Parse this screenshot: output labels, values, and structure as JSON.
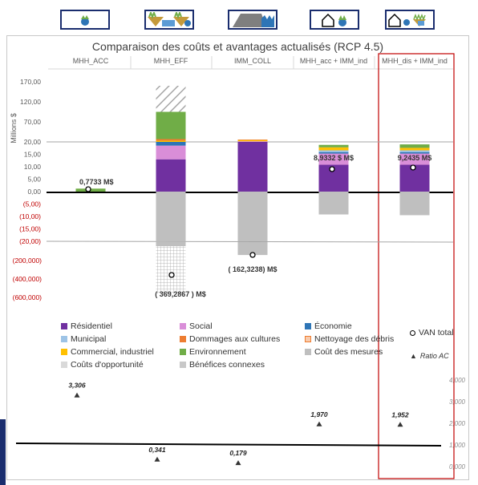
{
  "chart_data": {
    "type": "bar",
    "title": "Comparaison des coûts et avantages actualisés (RCP 4.5)",
    "ylabel": "Millions $",
    "categories": [
      "MHH_ACC",
      "MHH_EFF",
      "IMM_COLL",
      "MHH_acc + IMM_ind",
      "MHH_dis + IMM_ind"
    ],
    "highlighted_category": "MHH_dis + IMM_ind",
    "y_ticks_upper": [
      "170,00",
      "120,00",
      "70,00",
      "20,00"
    ],
    "y_ticks_middle": [
      "20,00",
      "15,00",
      "10,00",
      "5,00",
      "0,00",
      "(5,00)",
      "(10,00)",
      "(15,00)",
      "(20,00)"
    ],
    "y_ticks_lower": [
      "(200,000)",
      "(400,000)",
      "(600,000)"
    ],
    "series_colors": {
      "residentiel": "#7030a0",
      "social": "#d98ed8",
      "economie": "#2e75b6",
      "municipal": "#9dc3e6",
      "dommages_cultures": "#ed7d31",
      "nettoyage_debris": "#f8cbad",
      "commercial": "#ffc000",
      "environnement": "#70ad47",
      "cout_mesures": "#bfbfbf",
      "couts_opportunite": "#d9d9d9",
      "benefices_connexes": "#c8c8c8"
    },
    "npv_labels": [
      "0,7733 M$",
      "( 369,2867 ) M$",
      "( 162,3238) M$",
      "8,9332 $ M$",
      "9,2435 M$"
    ],
    "legend": [
      "Résidentiel",
      "Social",
      "Économie",
      "VAN total",
      "Municipal",
      "Dommages aux cultures",
      "Nettoyage des débris",
      "Commercial, industriel",
      "Environnement",
      "Coût des mesures",
      "Ratio AC",
      "Coûts d'opportunité",
      "Bénéfices connexes"
    ],
    "ratio_ac": {
      "values": [
        3.306,
        0.341,
        0.179,
        1.97,
        1.952
      ],
      "labels": [
        "3,306",
        "0,341",
        "0,179",
        "1,970",
        "1,952"
      ],
      "ylim": [
        0,
        4
      ],
      "ticks": [
        "4,000",
        "3,000",
        "2,000",
        "1,000",
        "0,000"
      ],
      "reference_line": 1.0
    }
  }
}
